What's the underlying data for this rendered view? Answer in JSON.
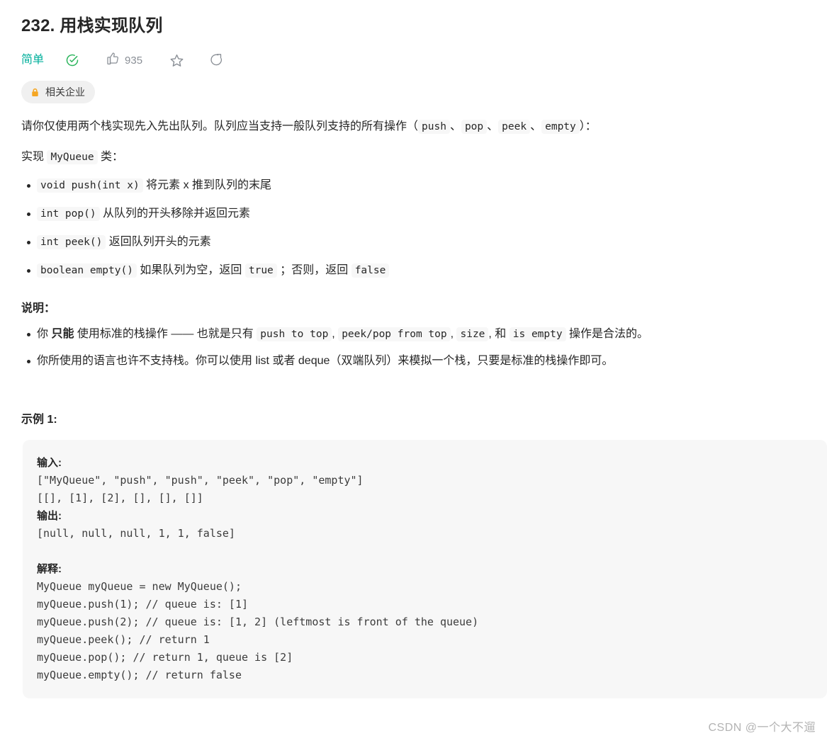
{
  "problem": {
    "title": "232. 用栈实现队列",
    "difficulty": "简单",
    "likes": "935",
    "company_badge": "相关企业"
  },
  "description": {
    "intro_1": "请你仅使用两个栈实现先入先出队列。队列应当支持一般队列支持的所有操作（",
    "intro_code_1": "push",
    "sep_1": "、",
    "intro_code_2": "pop",
    "sep_2": "、",
    "intro_code_3": "peek",
    "sep_3": "、",
    "intro_code_4": "empty",
    "intro_2": "）：",
    "implement_prefix": "实现 ",
    "implement_code": "MyQueue",
    "implement_suffix": " 类：",
    "methods": [
      {
        "code": "void push(int x)",
        "text": " 将元素 x 推到队列的末尾"
      },
      {
        "code": "int pop()",
        "text": " 从队列的开头移除并返回元素"
      },
      {
        "code": "int peek()",
        "text": " 返回队列开头的元素"
      },
      {
        "code": "boolean empty()",
        "text_before": " 如果队列为空，返回 ",
        "code_true": "true",
        "text_mid": " ；否则，返回 ",
        "code_false": "false"
      }
    ]
  },
  "notes": {
    "heading": "说明：",
    "note1_part1": "你 ",
    "note1_bold": "只能",
    "note1_part2": " 使用标准的栈操作 —— 也就是只有 ",
    "note1_code1": "push to top",
    "note1_sep1": ", ",
    "note1_code2": "peek/pop from top",
    "note1_sep2": ", ",
    "note1_code3": "size",
    "note1_sep3": ", 和 ",
    "note1_code4": "is empty",
    "note1_part3": " 操作是合法的。",
    "note2": "你所使用的语言也许不支持栈。你可以使用 list 或者 deque（双端队列）来模拟一个栈，只要是标准的栈操作即可。"
  },
  "example": {
    "heading": "示例 1:",
    "input_label": "输入:",
    "input_lines": [
      "[\"MyQueue\", \"push\", \"push\", \"peek\", \"pop\", \"empty\"]",
      "[[], [1], [2], [], [], []]"
    ],
    "output_label": "输出:",
    "output_lines": [
      "[null, null, null, 1, 1, false]"
    ],
    "explain_label": "解释:",
    "explain_lines": [
      "MyQueue myQueue = new MyQueue();",
      "myQueue.push(1); // queue is: [1]",
      "myQueue.push(2); // queue is: [1, 2] (leftmost is front of the queue)",
      "myQueue.peek(); // return 1",
      "myQueue.pop(); // return 1, queue is [2]",
      "myQueue.empty(); // return false"
    ]
  },
  "watermark": "CSDN @一个大不遛",
  "colors": {
    "difficulty": "#00af9b",
    "check": "#2db55d",
    "lock": "#f5a623",
    "code_bg": "#f7f7f7",
    "badge_bg": "#f0f0f0"
  }
}
